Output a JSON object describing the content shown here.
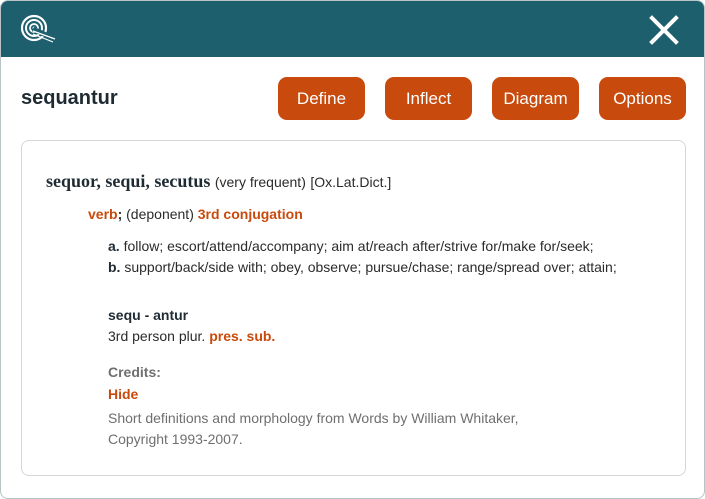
{
  "app": {
    "logo_icon": "spiral-logo-icon",
    "close_icon": "close-x-icon",
    "header_color": "#1e5f6e",
    "accent_color": "#c84a0c"
  },
  "toolbar": {
    "word": "sequantur",
    "buttons": {
      "define": "Define",
      "inflect": "Inflect",
      "diagram": "Diagram",
      "options": "Options"
    }
  },
  "entry": {
    "headword": "sequor, sequi, secutus",
    "frequency": "(very frequent)",
    "source": "[Ox.Lat.Dict.]",
    "pos": "verb",
    "pos_sep": ";",
    "pos_note": "(deponent)",
    "conjugation": "3rd conjugation",
    "senses": [
      {
        "letter": "a.",
        "text": "follow; escort/attend/accompany; aim at/reach after/strive for/make for/seek;"
      },
      {
        "letter": "b.",
        "text": "support/back/side with; obey, observe; pursue/chase; range/spread over; attain;"
      }
    ],
    "morphology": {
      "form": "sequ - antur",
      "description": "3rd person plur.",
      "tense": "pres. sub."
    }
  },
  "credits": {
    "label": "Credits:",
    "hide": "Hide",
    "line1": "Short definitions and morphology from Words by William Whitaker,",
    "line2": "Copyright 1993-2007."
  }
}
